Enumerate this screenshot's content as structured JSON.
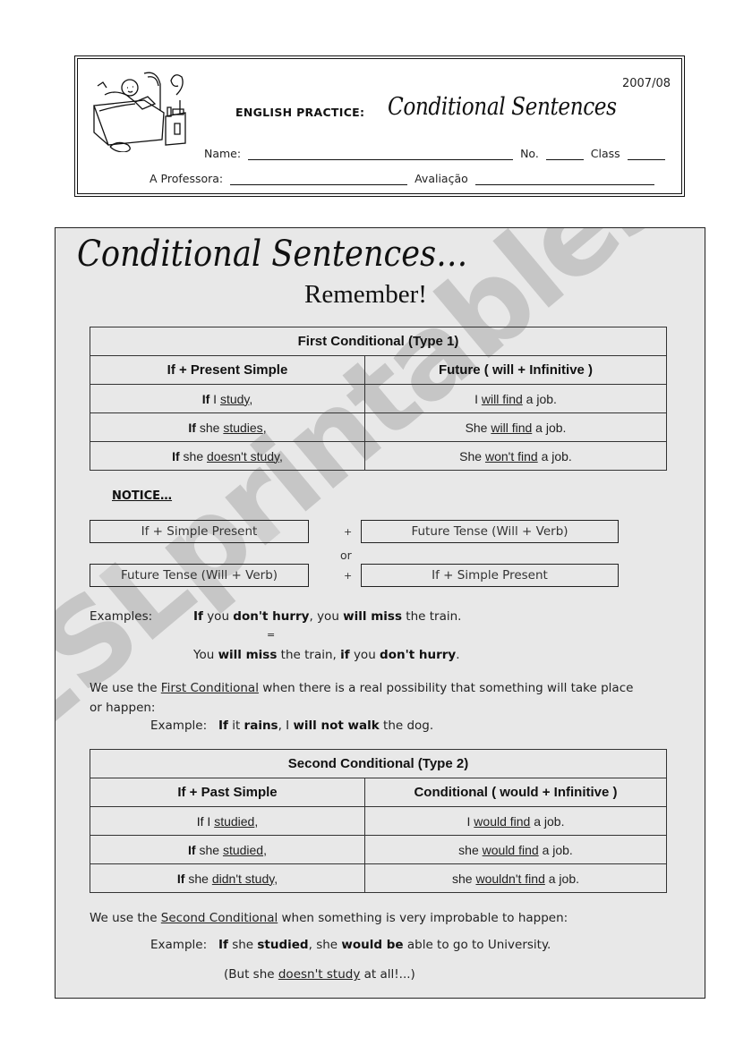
{
  "header": {
    "year": "2007/08",
    "subject_label": "ENGLISH PRACTICE:",
    "title": "Conditional Sentences",
    "name_label": "Name:",
    "number_label": "No.",
    "class_label": "Class",
    "teacher_label": "A Professora:",
    "grade_label": "Avaliação",
    "illustration": "child-reading-in-bed-illustration"
  },
  "panel": {
    "title": "Conditional Sentences…",
    "subtitle": "Remember!",
    "watermark": "ESLprintables.com"
  },
  "first_conditional": {
    "caption": "First Conditional (Type 1)",
    "columns": [
      "If + Present Simple",
      "Future ( will + Infinitive )"
    ],
    "rows": [
      {
        "if": "If",
        "subject": "I",
        "verb": "study",
        "end": ",",
        "res_subject": "I",
        "res_verb": "will find",
        "res_end": "a job."
      },
      {
        "if": "If",
        "subject": "she",
        "verb": "studies",
        "end": ",",
        "res_subject": "She",
        "res_verb": "will find",
        "res_end": "a job."
      },
      {
        "if": "If",
        "subject": "she",
        "verb": "doesn't study",
        "end": ",",
        "res_subject": "She",
        "res_verb": "won't find",
        "res_end": "a job."
      }
    ]
  },
  "notice": {
    "label": "NOTICE…",
    "box1": "If + Simple Present",
    "box2": "Future Tense (Will + Verb)",
    "box3": "Future Tense (Will + Verb)",
    "box4": "If + Simple Present",
    "plus": "+",
    "or": "or"
  },
  "examples": {
    "label": "Examples:",
    "line1": {
      "a": "If",
      "b": " you ",
      "c": "don't hurry",
      "d": ", you ",
      "e": "will miss",
      "f": " the train."
    },
    "equals": "=",
    "line2": {
      "a": "You ",
      "b": "will miss",
      "c": " the train, ",
      "d": "if",
      "e": " you ",
      "f": "don't hurry",
      "g": "."
    }
  },
  "first_usage": {
    "pre": "We use the ",
    "term": "First Conditional",
    "post": " when there is a real possibility that something will take place",
    "post2": "or happen:",
    "example_label": "Example:",
    "example": {
      "a": "If",
      "b": " it ",
      "c": "rains",
      "d": ", I ",
      "e": "will not walk",
      "f": " the dog."
    }
  },
  "second_conditional": {
    "caption": "Second Conditional (Type 2)",
    "columns": [
      "If + Past Simple",
      "Conditional ( would + Infinitive )"
    ],
    "rows": [
      {
        "if": "If",
        "subject": "I",
        "verb": "studied",
        "end": ",",
        "res_subject": "I",
        "res_verb": "would find",
        "res_end": "a job."
      },
      {
        "if": "If",
        "subject": "she",
        "verb": "studied",
        "end": ",",
        "res_subject": "she",
        "res_verb": "would find",
        "res_end": "a job."
      },
      {
        "if": "If",
        "subject": "she",
        "verb": "didn't study",
        "end": ",",
        "res_subject": "she",
        "res_verb": "wouldn't find",
        "res_end": "a job."
      }
    ]
  },
  "second_usage": {
    "pre": "We use the ",
    "term": "Second Conditional",
    "post": " when something is very improbable to happen:",
    "example_label": "Example:",
    "example": {
      "a": "If",
      "b": " she ",
      "c": "studied",
      "d": ", she ",
      "e": "would be",
      "f": " able to go to University."
    },
    "note": {
      "a": "(But she ",
      "b": "doesn't study",
      "c": " at all!...)"
    }
  }
}
